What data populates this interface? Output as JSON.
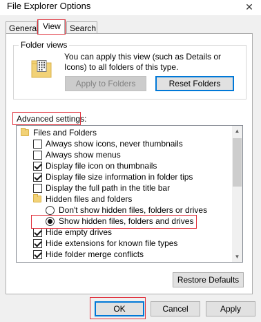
{
  "window": {
    "title": "File Explorer Options",
    "close_glyph": "✕"
  },
  "tabs": [
    {
      "label": "General",
      "active": false
    },
    {
      "label": "View",
      "active": true
    },
    {
      "label": "Search",
      "active": false
    }
  ],
  "folder_views": {
    "label": "Folder views",
    "description": "You can apply this view (such as Details or Icons) to all folders of this type.",
    "apply_button": "Apply to Folders",
    "reset_button": "Reset Folders"
  },
  "advanced": {
    "label": "Advanced settings:",
    "items": [
      {
        "kind": "folder",
        "label": "Files and Folders"
      },
      {
        "kind": "checkbox",
        "checked": false,
        "label": "Always show icons, never thumbnails"
      },
      {
        "kind": "checkbox",
        "checked": false,
        "label": "Always show menus"
      },
      {
        "kind": "checkbox",
        "checked": true,
        "label": "Display file icon on thumbnails"
      },
      {
        "kind": "checkbox",
        "checked": true,
        "label": "Display file size information in folder tips"
      },
      {
        "kind": "checkbox",
        "checked": false,
        "label": "Display the full path in the title bar"
      },
      {
        "kind": "folder",
        "label": "Hidden files and folders"
      },
      {
        "kind": "radio",
        "selected": false,
        "label": "Don't show hidden files, folders or drives"
      },
      {
        "kind": "radio",
        "selected": true,
        "label": "Show hidden files, folders and drives"
      },
      {
        "kind": "checkbox",
        "checked": true,
        "label": "Hide empty drives"
      },
      {
        "kind": "checkbox",
        "checked": true,
        "label": "Hide extensions for known file types"
      },
      {
        "kind": "checkbox",
        "checked": true,
        "label": "Hide folder merge conflicts"
      }
    ],
    "restore_button": "Restore Defaults"
  },
  "footer": {
    "ok": "OK",
    "cancel": "Cancel",
    "apply": "Apply"
  },
  "colors": {
    "highlight": "#e0303b",
    "folder": "#f2d277",
    "accent": "#0078d7"
  },
  "icons": {
    "folder_views": "folder-grid-icon",
    "close": "close-icon"
  }
}
